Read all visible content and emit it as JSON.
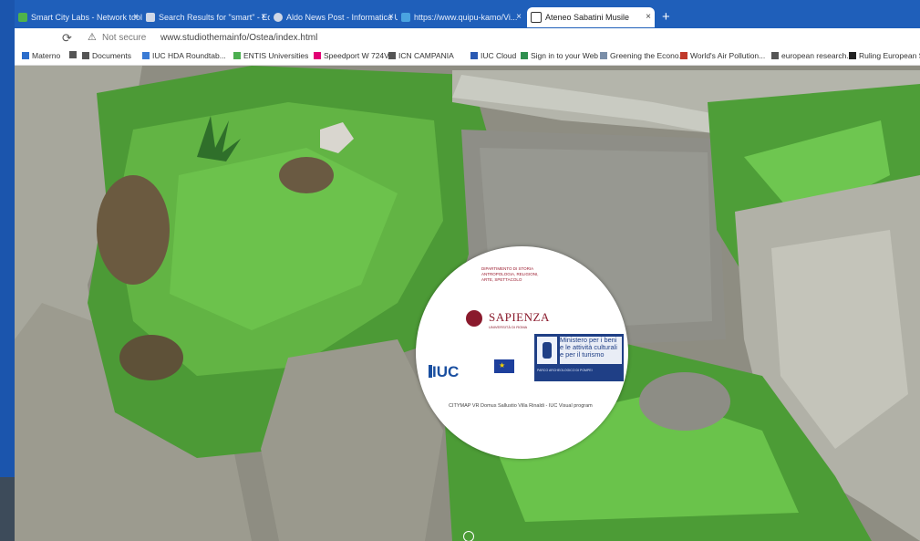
{
  "browser": {
    "tabs": [
      {
        "label": "Smart City Labs - Network tools t...",
        "icon_color": "#4fb34b",
        "active": false
      },
      {
        "label": "Search Results for \"smart\" - Edu...",
        "icon_color": "#d0d8e8",
        "active": false
      },
      {
        "label": "Aldo News Post - Informatica Uni...",
        "icon_color": "#cfd7e6",
        "active": false
      },
      {
        "label": "https://www.quipu-kamo/Vi...",
        "icon_color": "#4aa3e0",
        "active": false
      },
      {
        "label": "Ateneo Sabatini Musile",
        "icon_color": "#ffffff",
        "active": true
      }
    ],
    "tab_close_glyph": "×",
    "new_tab_glyph": "+",
    "reload_glyph": "⟳",
    "not_secure_glyph": "⚠",
    "not_secure_label": "Not secure",
    "url": "www.studiothemainfo/Ostea/index.html",
    "bookmarks": [
      {
        "label": "Materno",
        "icon": "page-icon",
        "icon_color": "#2c6ecb"
      },
      {
        "label": "",
        "icon": "page-icon",
        "icon_color": "#555555"
      },
      {
        "label": "Documents",
        "icon": "page-icon",
        "icon_color": "#555555"
      },
      {
        "label": "IUC HDA Roundtab...",
        "icon": "globe-icon",
        "icon_color": "#3a7bd5"
      },
      {
        "label": "ENTIS Universities",
        "icon": "green-icon",
        "icon_color": "#4caf50"
      },
      {
        "label": "Speedport W 724V",
        "icon": "telekom-icon",
        "icon_color": "#e20074"
      },
      {
        "label": "ICN CAMPANIA",
        "icon": "page-icon",
        "icon_color": "#555555"
      },
      {
        "label": "IUC Cloud",
        "icon": "cloud-icon",
        "icon_color": "#2a5ab3"
      },
      {
        "label": "Sign in to your Web",
        "icon": "globe-icon",
        "icon_color": "#2f8f4f"
      },
      {
        "label": "Greening the Econo...",
        "icon": "link-icon",
        "icon_color": "#7a8ea8"
      },
      {
        "label": "World's Air Pollution...",
        "icon": "map-icon",
        "icon_color": "#c0392b"
      },
      {
        "label": "european research...",
        "icon": "page-icon",
        "icon_color": "#555555"
      },
      {
        "label": "Ruling European Stu...",
        "icon": "book-icon",
        "icon_color": "#222222"
      }
    ]
  },
  "panorama": {
    "logo_disc": {
      "sapienza_header_lines": [
        "DIPARTIMENTO DI STORIA",
        "ANTROPOLOGIA, RELIGIONI,",
        "ARTE, SPETTACOLO"
      ],
      "sapienza_name": "SAPIENZA",
      "sapienza_sub": "UNIVERSITÀ DI ROMA",
      "iuc_name": "IUC",
      "eu_stars": "★",
      "mibac_text": "Ministero per i beni e le attività culturali e per il turismo",
      "mibac_footer": "PARCO ARCHEOLOGICO DI POMPEI",
      "caption": "CITYMAP VR Domus Sallustio Villa Rinaldi - IUC Visual program"
    },
    "accent_colors": {
      "sapienza": "#8a1a2c",
      "iuc": "#1a4fa0",
      "mibac": "#1f3f86",
      "eu_star": "#f3d100"
    }
  }
}
